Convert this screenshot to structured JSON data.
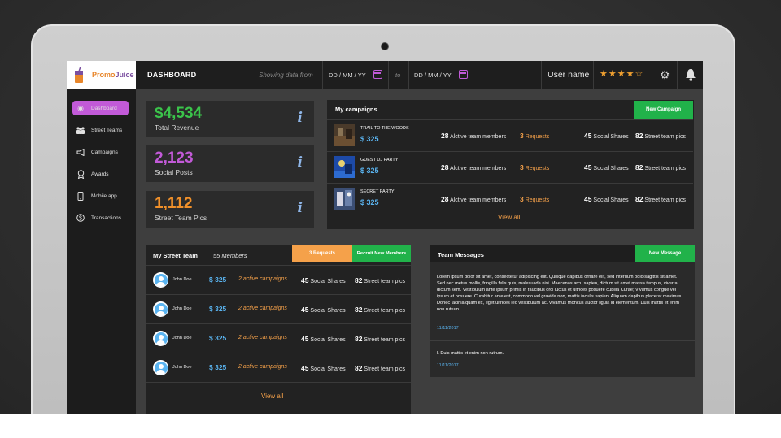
{
  "app": {
    "logo": {
      "part1": "Promo",
      "part2": "Juice"
    },
    "page_title": "DASHBOARD",
    "showing_label": "Showing data from",
    "date_from": "DD / MM / YY",
    "date_to_label": "to",
    "date_to": "DD / MM / YY",
    "user_name": "User name",
    "rating": {
      "filled": "★★★★",
      "empty": "☆"
    }
  },
  "sidebar": {
    "items": [
      {
        "label": "Dashboard",
        "icon": "dashboard-icon",
        "glyph": "◉"
      },
      {
        "label": "Street Teams",
        "icon": "team-icon",
        "glyph": "👥"
      },
      {
        "label": "Campaigns",
        "icon": "megaphone-icon",
        "glyph": "📣"
      },
      {
        "label": "Awards",
        "icon": "award-icon",
        "glyph": "🏅"
      },
      {
        "label": "Mobile app",
        "icon": "mobile-icon",
        "glyph": "📱"
      },
      {
        "label": "Transactions",
        "icon": "dollar-icon",
        "glyph": "$"
      }
    ]
  },
  "stats": [
    {
      "value": "$4,534",
      "label": "Total Revenue",
      "color": "#3bc44b"
    },
    {
      "value": "2,123",
      "label": "Social Posts",
      "color": "#c25ad8"
    },
    {
      "value": "1,112",
      "label": "Street Team Pics",
      "color": "#f0902a"
    }
  ],
  "campaigns": {
    "title": "My campaigns",
    "new_button": "New Campaign",
    "rows": [
      {
        "name": "TRAIL TO THE WOODS",
        "price": "$ 325",
        "members_num": "28",
        "members_label": "Alctive team members",
        "requests_num": "3",
        "requests_label": "Requests",
        "shares_num": "45",
        "shares_label": "Social Shares",
        "pics_num": "82",
        "pics_label": "Street team pics"
      },
      {
        "name": "GUEST DJ PARTY",
        "price": "$ 325",
        "members_num": "28",
        "members_label": "Alctive team members",
        "requests_num": "3",
        "requests_label": "Requests",
        "shares_num": "45",
        "shares_label": "Social Shares",
        "pics_num": "82",
        "pics_label": "Street team pics"
      },
      {
        "name": "SECRET PARTY",
        "price": "$ 325",
        "members_num": "28",
        "members_label": "Alctive team members",
        "requests_num": "3",
        "requests_label": "Requests",
        "shares_num": "45",
        "shares_label": "Social Shares",
        "pics_num": "82",
        "pics_label": "Street team pics"
      }
    ],
    "view_all": "View all"
  },
  "street_team": {
    "title": "My Street Team",
    "members": "55 Members",
    "requests_button": "3 Requests",
    "recruit_button": "Recruit New Members",
    "rows": [
      {
        "name": "John Doe",
        "price": "$ 325",
        "campaigns": "2 active campaigns",
        "shares_num": "45",
        "shares_label": "Social Shares",
        "pics_num": "82",
        "pics_label": "Street team pics"
      },
      {
        "name": "John Doe",
        "price": "$ 325",
        "campaigns": "2 active campaigns",
        "shares_num": "45",
        "shares_label": "Social Shares",
        "pics_num": "82",
        "pics_label": "Street team pics"
      },
      {
        "name": "John Doe",
        "price": "$ 325",
        "campaigns": "2 active campaigns",
        "shares_num": "45",
        "shares_label": "Social Shares",
        "pics_num": "82",
        "pics_label": "Street team pics"
      },
      {
        "name": "John Doe",
        "price": "$ 325",
        "campaigns": "2 active campaigns",
        "shares_num": "45",
        "shares_label": "Social Shares",
        "pics_num": "82",
        "pics_label": "Street team pics"
      }
    ],
    "view_all": "View all"
  },
  "messages": {
    "title": "Team Messages",
    "new_button": "New Message",
    "items": [
      {
        "text": "Lorem ipsum dolor sit amet, consectetur adipiscing elit. Quisque dapibus ornare elit, sed interdum odio sagittis sit amet. Sed nec metus mollis, fringilla felis quis, malesuada nisi. Maecenas arcu sapien, dictum sit amet massa tempus, viverra dictum sem. Vestibulum ante ipsum primis in faucibus orci luctus et ultrices posuere cubilia Curae; Vivamus congue vel ipsum et posuere. Curabitur ante est, commodo vel gravida non, mattis iaculis sapien. Aliquam dapibus placerat maximus. Donec lacinia quam ex, eget ultrices leo vestibulum ac. Vivamus rhoncus auctor ligula id elementum. Duis mattis et enim non rutrum.",
        "date": "11/11/2017"
      },
      {
        "text": "l. Duis mattis et enim non rutrum.",
        "date": "11/11/2017"
      }
    ]
  }
}
